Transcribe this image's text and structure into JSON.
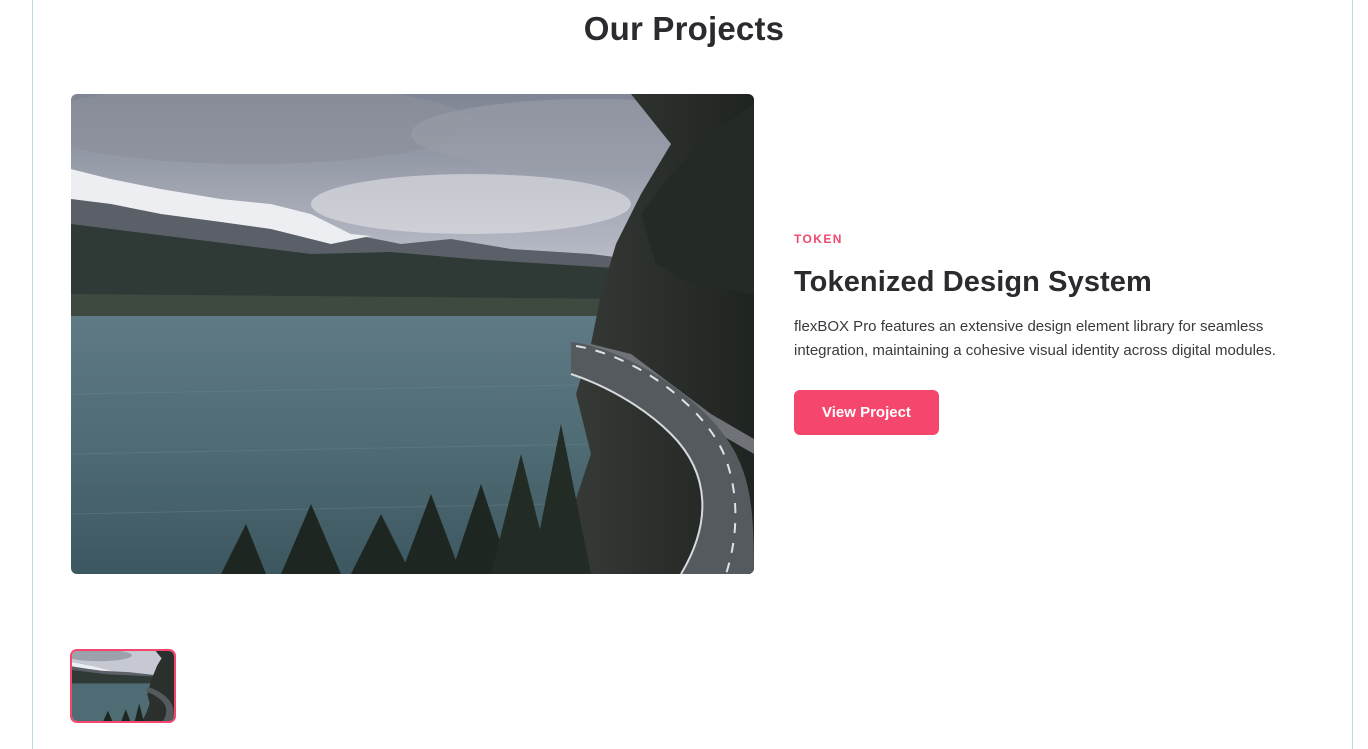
{
  "section": {
    "title": "Our Projects"
  },
  "project": {
    "category": "TOKEN",
    "title": "Tokenized Design System",
    "description": "flexBOX Pro features an extensive design element library for seamless integration, maintaining a cohesive visual identity across digital modules.",
    "cta_label": "View Project",
    "image": "lake-mountain-road-photo"
  },
  "thumbnails": [
    {
      "image": "lake-mountain-road-photo",
      "active": true
    }
  ],
  "colors": {
    "accent": "#f5476d",
    "text": "#2b2b2f",
    "frame_border": "#bcdcec"
  }
}
